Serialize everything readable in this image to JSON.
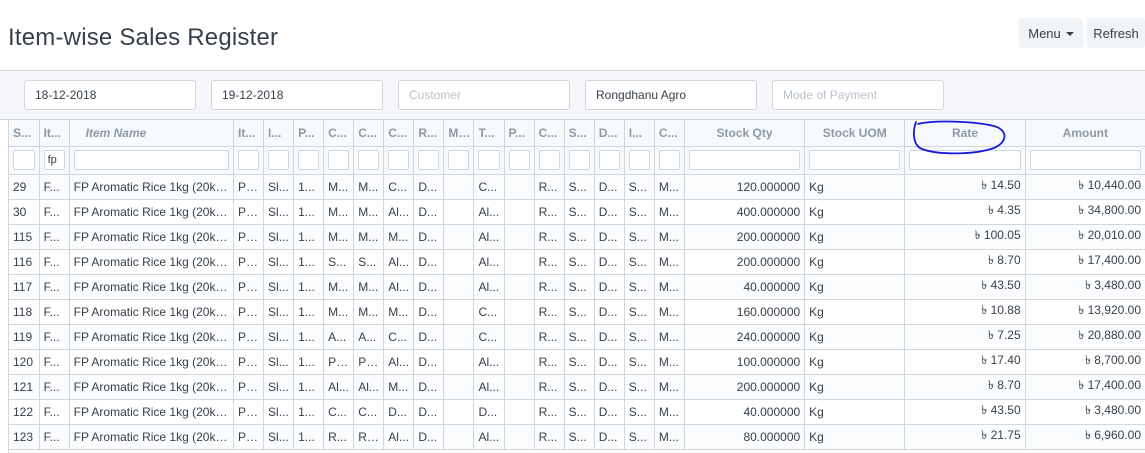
{
  "page": {
    "title": "Item-wise Sales Register"
  },
  "toolbar": {
    "menu_label": "Menu",
    "refresh_label": "Refresh"
  },
  "filters": {
    "from_date": "18-12-2018",
    "to_date": "19-12-2018",
    "customer_placeholder": "Customer",
    "company": "Rongdhanu Agro",
    "mode_of_payment_placeholder": "Mode of Payment"
  },
  "columns": [
    "S...",
    "It...",
    "Item Name",
    "It...",
    "I...",
    "P...",
    "C...",
    "C...",
    "C...",
    "R...",
    "Mod",
    "T...",
    "P...",
    "C...",
    "S...",
    "D...",
    "I...",
    "C...",
    "Stock Qty",
    "Stock UOM",
    "Rate",
    "Amount"
  ],
  "column_filters": {
    "item_code": "fp"
  },
  "rows": [
    [
      "29",
      "F...",
      "FP Aromatic Rice 1kg (20kg...",
      "Pr...",
      "Sl...",
      "1...",
      "M...",
      "M...",
      "C...",
      "D...",
      "",
      "C...",
      "",
      "R...",
      "S...",
      "D...",
      "S...",
      "M...",
      "120.000000",
      "Kg",
      "৳ 14.50",
      "৳ 10,440.00"
    ],
    [
      "30",
      "F...",
      "FP Aromatic Rice 1kg (20kg...",
      "Pr...",
      "Sl...",
      "1...",
      "M...",
      "M...",
      "Al...",
      "D...",
      "",
      "Al...",
      "",
      "R...",
      "S...",
      "D...",
      "S...",
      "M...",
      "400.000000",
      "Kg",
      "৳ 4.35",
      "৳ 34,800.00"
    ],
    [
      "115",
      "F...",
      "FP Aromatic Rice 1kg (20kg...",
      "Pr...",
      "Sl...",
      "1...",
      "M...",
      "M...",
      "M...",
      "D...",
      "",
      "Al...",
      "",
      "R...",
      "S...",
      "D...",
      "S...",
      "M...",
      "200.000000",
      "Kg",
      "৳ 100.05",
      "৳ 20,010.00"
    ],
    [
      "116",
      "F...",
      "FP Aromatic Rice 1kg (20kg...",
      "Pr...",
      "Sl...",
      "1...",
      "S...",
      "S...",
      "Al...",
      "D...",
      "",
      "Al...",
      "",
      "R...",
      "S...",
      "D...",
      "S...",
      "M...",
      "200.000000",
      "Kg",
      "৳ 8.70",
      "৳ 17,400.00"
    ],
    [
      "117",
      "F...",
      "FP Aromatic Rice 1kg (20kg...",
      "Pr...",
      "Sl...",
      "1...",
      "M...",
      "M...",
      "Al...",
      "D...",
      "",
      "Al...",
      "",
      "R...",
      "S...",
      "D...",
      "S...",
      "M...",
      "40.000000",
      "Kg",
      "৳ 43.50",
      "৳ 3,480.00"
    ],
    [
      "118",
      "F...",
      "FP Aromatic Rice 1kg (20kg...",
      "Pr...",
      "Sl...",
      "1...",
      "M...",
      "M...",
      "M...",
      "D...",
      "",
      "C...",
      "",
      "R...",
      "S...",
      "D...",
      "S...",
      "M...",
      "160.000000",
      "Kg",
      "৳ 10.88",
      "৳ 13,920.00"
    ],
    [
      "119",
      "F...",
      "FP Aromatic Rice 1kg (20kg...",
      "Pr...",
      "Sl...",
      "1...",
      "A...",
      "A...",
      "C...",
      "D...",
      "",
      "C...",
      "",
      "R...",
      "S...",
      "D...",
      "S...",
      "M...",
      "240.000000",
      "Kg",
      "৳ 7.25",
      "৳ 20,880.00"
    ],
    [
      "120",
      "F...",
      "FP Aromatic Rice 1kg (20kg...",
      "Pr...",
      "Sl...",
      "1...",
      "Pr...",
      "Pr...",
      "Al...",
      "D...",
      "",
      "Al...",
      "",
      "R...",
      "S...",
      "D...",
      "S...",
      "M...",
      "100.000000",
      "Kg",
      "৳ 17.40",
      "৳ 8,700.00"
    ],
    [
      "121",
      "F...",
      "FP Aromatic Rice 1kg (20kg...",
      "Pr...",
      "Sl...",
      "1...",
      "Al...",
      "Al...",
      "M...",
      "D...",
      "",
      "Al...",
      "",
      "R...",
      "S...",
      "D...",
      "S...",
      "M...",
      "200.000000",
      "Kg",
      "৳ 8.70",
      "৳ 17,400.00"
    ],
    [
      "122",
      "F...",
      "FP Aromatic Rice 1kg (20kg...",
      "Pr...",
      "Sl...",
      "1...",
      "C...",
      "C...",
      "D...",
      "D...",
      "",
      "D...",
      "",
      "R...",
      "S...",
      "D...",
      "S...",
      "M...",
      "40.000000",
      "Kg",
      "৳ 43.50",
      "৳ 3,480.00"
    ],
    [
      "123",
      "F...",
      "FP Aromatic Rice 1kg (20kg...",
      "Pr...",
      "Sl...",
      "1...",
      "R...",
      "Ri...",
      "Al...",
      "D...",
      "",
      "Al...",
      "",
      "R...",
      "S...",
      "D...",
      "S...",
      "M...",
      "80.000000",
      "Kg",
      "৳ 21.75",
      "৳ 6,960.00"
    ]
  ],
  "annotation": {
    "shape": "hand-drawn-ellipse",
    "color": "#1a1adb",
    "target": "Rate"
  },
  "colors": {
    "border": "#d1d8dd",
    "header_bg": "#f7fafc",
    "filter_bg": "#f5f7fa",
    "text": "#36414c",
    "muted": "#8d99a6"
  }
}
